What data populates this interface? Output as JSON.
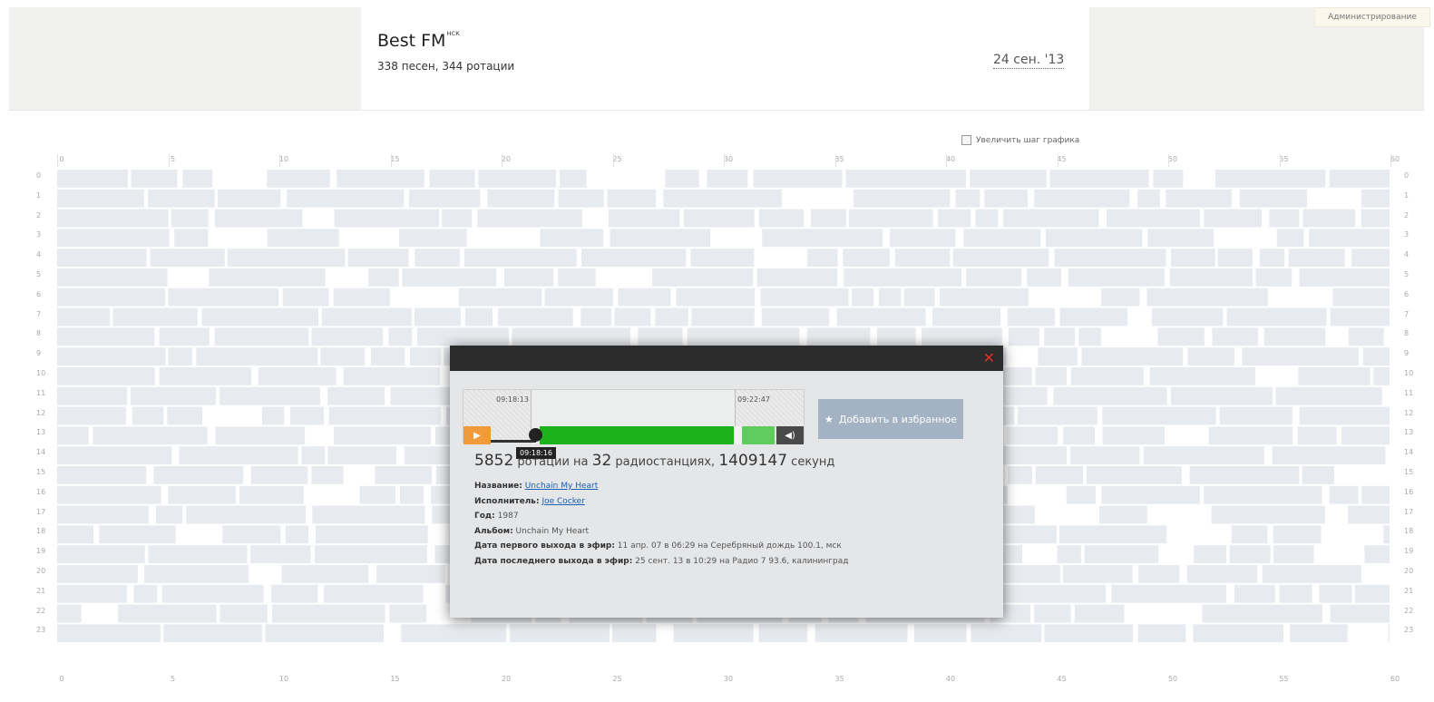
{
  "header": {
    "station_name": "Best FM",
    "station_suffix": "нск",
    "stats": "338 песен, 344 ротации",
    "date": "24 сен. '13",
    "admin_link": "Администрирование"
  },
  "chart": {
    "zoom_label": "Увеличить шаг графика",
    "minute_ticks": [
      "0",
      "5",
      "10",
      "15",
      "20",
      "25",
      "30",
      "35",
      "40",
      "45",
      "50",
      "55",
      "60"
    ],
    "hour_rows": [
      "0",
      "1",
      "2",
      "3",
      "4",
      "5",
      "6",
      "7",
      "8",
      "9",
      "10",
      "11",
      "12",
      "13",
      "14",
      "15",
      "16",
      "17",
      "18",
      "19",
      "20",
      "21",
      "22",
      "23"
    ],
    "colors": {
      "cell": "#e7eaee",
      "gap": "#ffffff"
    }
  },
  "popup": {
    "close_icon": "close-icon",
    "window_start": "09:18:13",
    "window_end": "09:22:47",
    "current_time": "09:18:16",
    "play_icon": "play-icon",
    "volume_icon": "volume-icon",
    "favorite_label": "Добавить в избранное",
    "stats": {
      "rotations": "5852",
      "rotations_text": "ротации на",
      "stations": "32",
      "stations_text": "радиостанциях,",
      "seconds": "1409147",
      "seconds_text": "секунд"
    },
    "info": {
      "title_label": "Название:",
      "title_value": "Unchain My Heart",
      "artist_label": "Исполнитель:",
      "artist_value": "Joe Cocker",
      "year_label": "Год:",
      "year_value": "1987",
      "album_label": "Альбом:",
      "album_value": "Unchain My Heart",
      "first_label": "Дата первого выхода в эфир:",
      "first_value": "11 апр. 07 в 06:29 на Серебряный дождь 100.1, мск",
      "last_label": "Дата последнего выхода в эфир:",
      "last_value": "25 сент. 13 в 10:29 на Радио 7 93.6, калининград"
    }
  }
}
